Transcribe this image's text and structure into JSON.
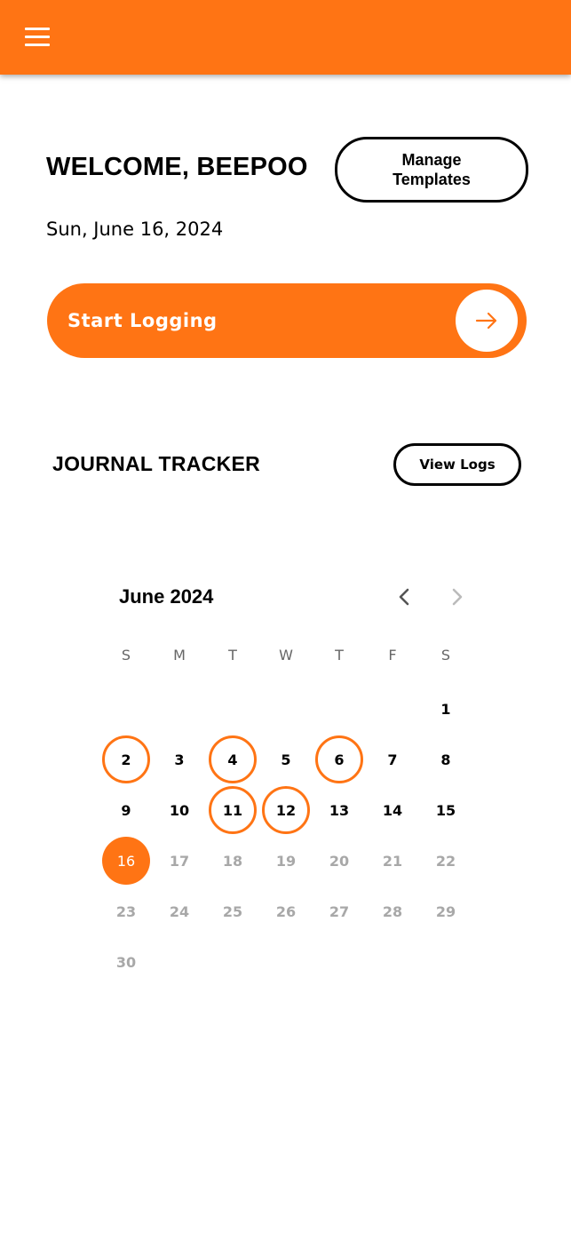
{
  "header": {
    "menu_icon": "hamburger-menu-icon",
    "bar_color": "#ff7414"
  },
  "welcome": {
    "title": "WELCOME, BEEPOO",
    "manage_templates_label": "Manage Templates",
    "date": "Sun, June 16, 2024"
  },
  "start_logging": {
    "label": "Start Logging",
    "icon": "arrow-right-icon"
  },
  "tracker": {
    "title": "JOURNAL TRACKER",
    "view_logs_label": "View Logs"
  },
  "calendar": {
    "month_label": "June 2024",
    "prev_icon": "chevron-left-icon",
    "next_icon": "chevron-right-icon",
    "weekdays": [
      "S",
      "M",
      "T",
      "W",
      "T",
      "F",
      "S"
    ],
    "first_weekday_index": 6,
    "days_in_month": 30,
    "today": 16,
    "logged_days": [
      2,
      4,
      6,
      11,
      12
    ],
    "accent_color": "#ff7414",
    "future_color": "#a8a8a8"
  }
}
